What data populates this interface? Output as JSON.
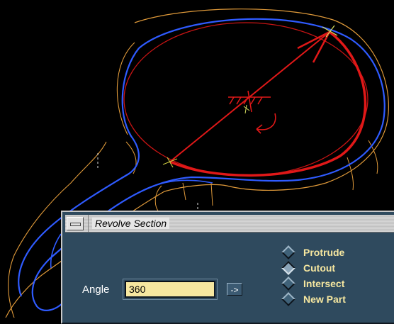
{
  "dialog": {
    "title": "Revolve Section",
    "angle_label": "Angle",
    "angle_value": "360",
    "arrow_button": "->",
    "options": [
      {
        "label": "Protrude",
        "selected": false
      },
      {
        "label": "Cutout",
        "selected": true
      },
      {
        "label": "Intersect",
        "selected": false
      },
      {
        "label": "New Part",
        "selected": false
      }
    ]
  },
  "colors": {
    "background": "#000000",
    "blue_outline": "#2f5bff",
    "orange_outline": "#e09a3a",
    "red_section": "#e01818",
    "dialog_bg": "#2f4a5e",
    "label_yellow": "#f6e7a0"
  }
}
